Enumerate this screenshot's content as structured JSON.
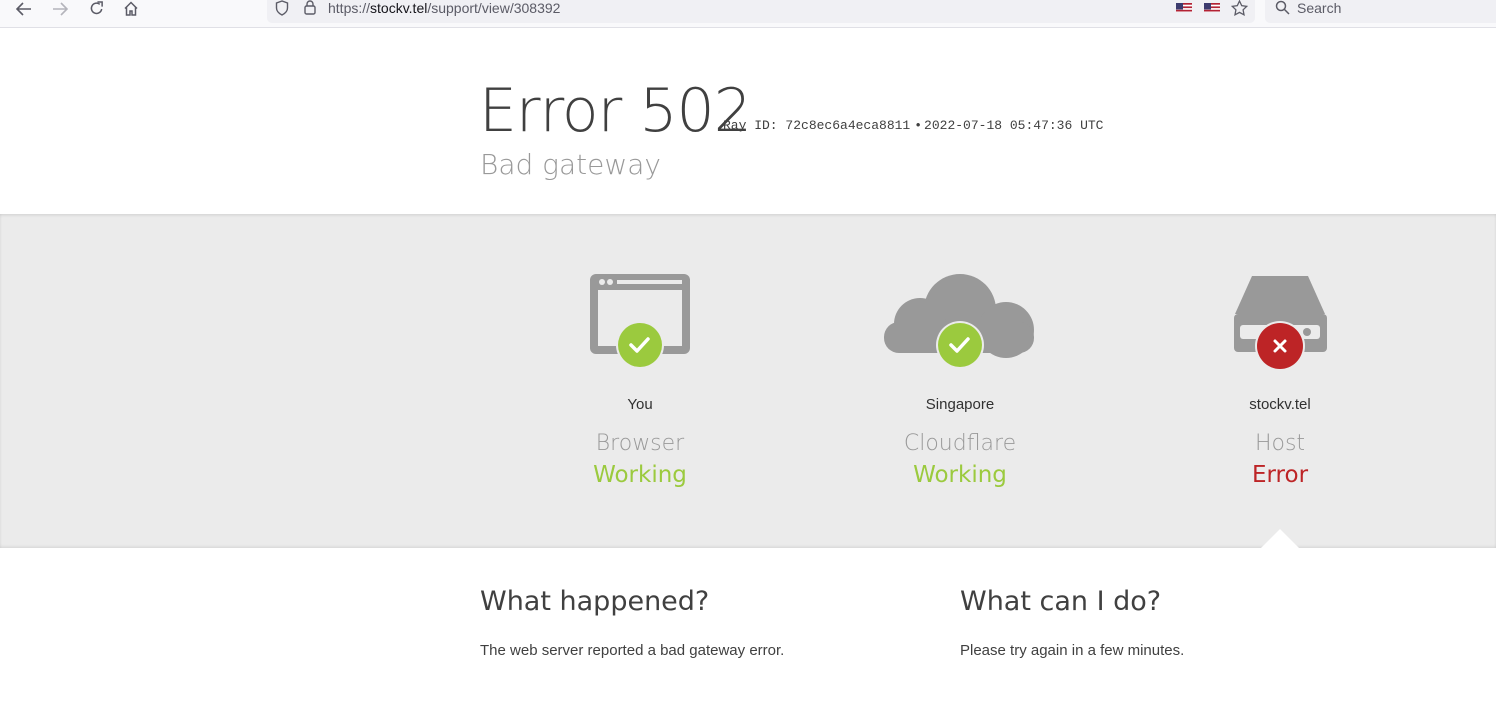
{
  "browser": {
    "url_prefix": "https://",
    "url_host": "stockv.tel",
    "url_path": "/support/view/308392",
    "search_placeholder": "Search",
    "icons": [
      "back-arrow-icon",
      "forward-arrow-icon",
      "reload-icon",
      "home-icon",
      "shield-icon",
      "lock-icon",
      "flag-icon",
      "star-icon",
      "search-icon"
    ]
  },
  "header": {
    "error_title": "Error 502",
    "ray_label": "Ray ID: 72c8ec6a4eca8811",
    "bullet": "•",
    "timestamp": "2022-07-18 05:47:36 UTC",
    "subtitle": "Bad gateway"
  },
  "nodes": [
    {
      "location": "You",
      "name": "Browser",
      "status": "Working",
      "state": "ok",
      "icon": "browser-window-icon"
    },
    {
      "location": "Singapore",
      "name": "Cloudflare",
      "status": "Working",
      "state": "ok",
      "icon": "cloud-icon"
    },
    {
      "location": "stockv.tel",
      "name": "Host",
      "status": "Error",
      "state": "error",
      "icon": "server-icon"
    }
  ],
  "colors": {
    "ok": "#9bca3e",
    "error": "#bd2426",
    "icon_gray": "#999999",
    "band": "#ebebeb"
  },
  "info": {
    "happened_title": "What happened?",
    "happened_text": "The web server reported a bad gateway error.",
    "cando_title": "What can I do?",
    "cando_text": "Please try again in a few minutes."
  }
}
